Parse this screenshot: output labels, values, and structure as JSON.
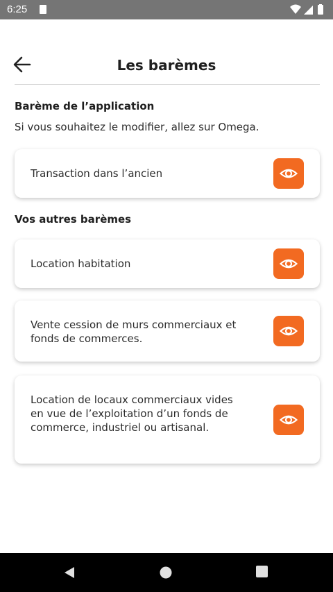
{
  "status_bar": {
    "time": "6:25",
    "icons": [
      "sd-card-icon",
      "wifi-icon",
      "cell-signal-icon",
      "battery-icon"
    ]
  },
  "header": {
    "title": "Les barèmes",
    "back_icon": "arrow-left-icon"
  },
  "app_scale": {
    "heading": "Barème de l’application",
    "description": "Si vous souhaitez le modifier, allez sur Omega.",
    "items": [
      {
        "label": "Transaction dans l’ancien"
      }
    ]
  },
  "other_scales": {
    "heading": "Vos autres barèmes",
    "items": [
      {
        "label": "Location habitation"
      },
      {
        "label": "Vente cession de murs commerciaux et fonds de commerces."
      },
      {
        "label": "Location de locaux commerciaux vides en vue de l’exploitation d’un fonds de commerce, industriel ou artisanal."
      }
    ]
  },
  "colors": {
    "accent": "#f26a21",
    "status_bar": "#757575",
    "nav_bar": "#000000"
  },
  "nav_bar": {
    "icons": [
      "nav-back-icon",
      "nav-home-icon",
      "nav-recents-icon"
    ]
  }
}
